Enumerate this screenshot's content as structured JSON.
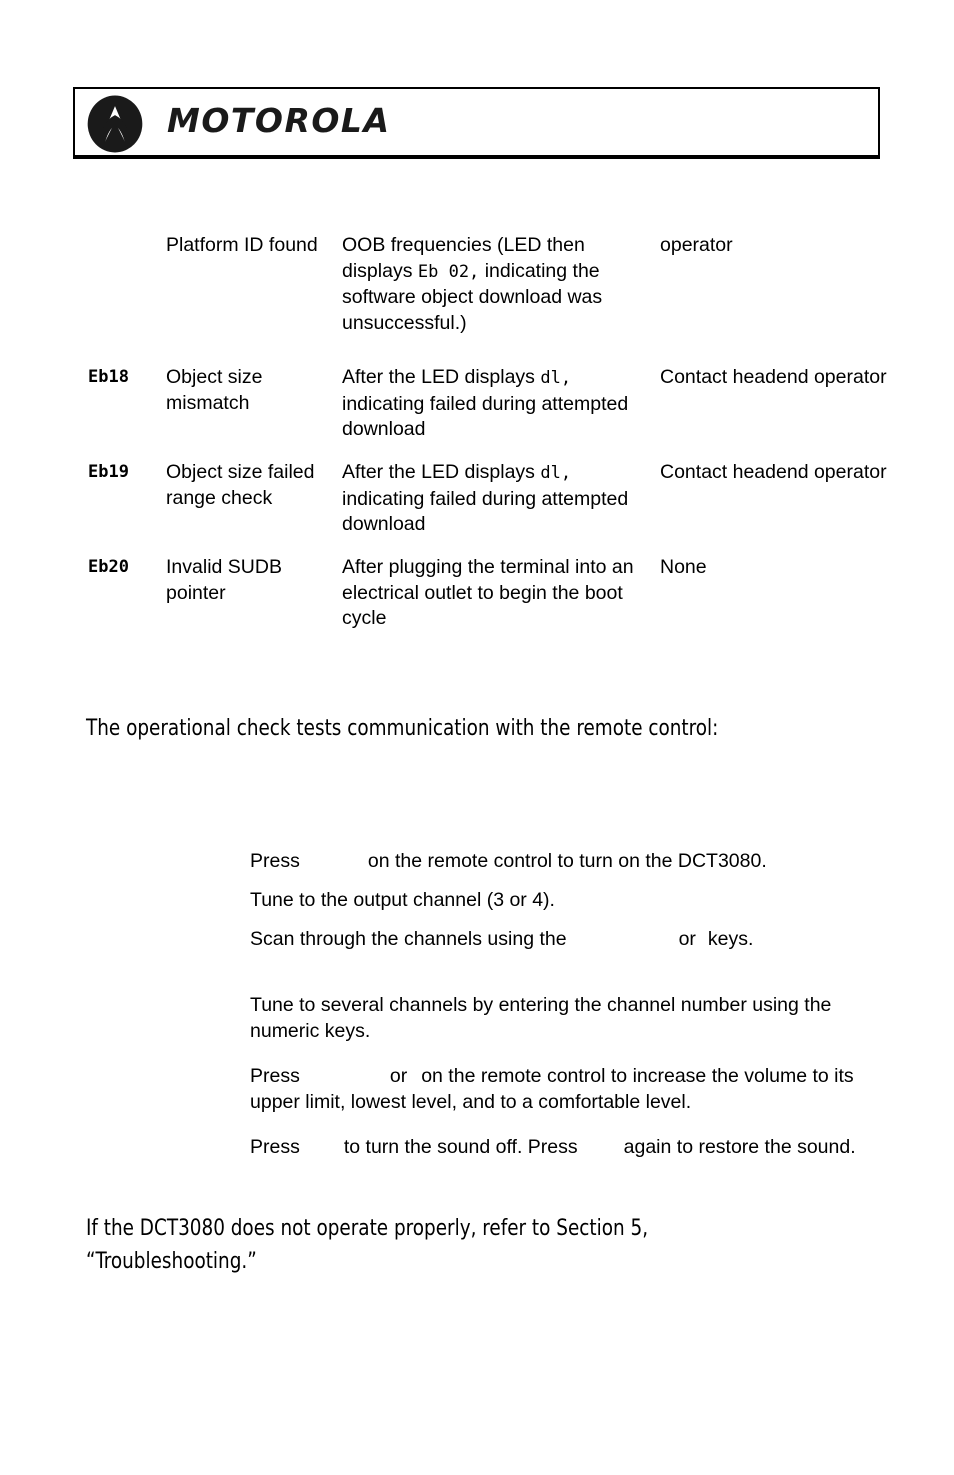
{
  "header": {
    "brand": "MOTOROLA",
    "logo_icon": "motorola-batwing-icon"
  },
  "error_table": {
    "rows": [
      {
        "code": "",
        "description": "Platform ID found",
        "condition_pre": "OOB frequencies (LED then displays ",
        "condition_code": "Eb 02,",
        "condition_post": " indicating the software object download was unsuccessful.)",
        "action": "operator"
      },
      {
        "code": "Eb18",
        "description": "Object size mismatch",
        "condition_pre": "After the LED displays ",
        "condition_code": "dl,",
        "condition_post": " indicating failed during attempted download",
        "action": "Contact headend operator"
      },
      {
        "code": "Eb19",
        "description": "Object size failed range check",
        "condition_pre": "After the LED displays ",
        "condition_code": "dl,",
        "condition_post": " indicating failed during attempted download",
        "action": "Contact headend operator"
      },
      {
        "code": "Eb20",
        "description": "Invalid SUDB pointer",
        "condition_pre": "After plugging the terminal into an electrical outlet to begin the boot cycle",
        "condition_code": "",
        "condition_post": "",
        "action": "None"
      }
    ]
  },
  "intro": {
    "text": "The operational check tests communication with the remote control:"
  },
  "steps": [
    {
      "part1": "Press",
      "part2": "on the remote control to turn on the DCT3080."
    },
    {
      "part1": "Tune to the output channel (3 or 4).",
      "part2": ""
    },
    {
      "part1": "Scan through the channels using the",
      "part2": "or",
      "part3": "keys."
    },
    {
      "part1": "Tune to several channels by entering the channel number using the numeric keys.",
      "part2": ""
    },
    {
      "part1": "Press",
      "part2": "or",
      "part3": "on the remote control to increase the volume to its upper limit, lowest level, and to a comfortable level."
    },
    {
      "part1": "Press",
      "part2": "to turn the sound off. Press",
      "part3": "again to restore the sound."
    }
  ],
  "closing": {
    "line1": "If the DCT3080 does not operate properly, refer to Section 5,",
    "line2": "“Troubleshooting.”"
  }
}
